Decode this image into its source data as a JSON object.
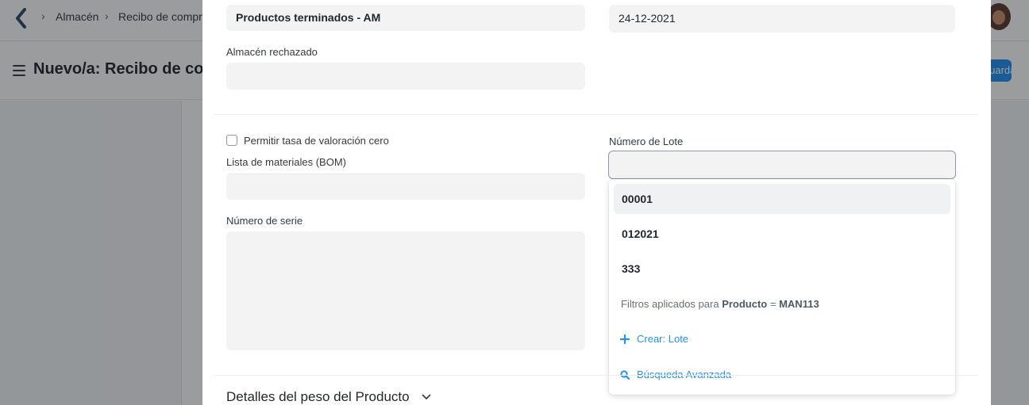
{
  "navbar": {
    "breadcrumbs": [
      "Almacén",
      "Recibo de compra"
    ]
  },
  "page": {
    "title": "Nuevo/a: Recibo de compra",
    "save_label": "Guardar"
  },
  "dialog": {
    "warehouse_value": "Productos terminados - AM",
    "date_value": "24-12-2021",
    "rejected_warehouse_label": "Almacén rechazado",
    "rejected_warehouse_value": "",
    "zero_valuation_label": "Permitir tasa de valoración cero",
    "bom_label": "Lista de materiales (BOM)",
    "bom_value": "",
    "serial_label": "Número de serie",
    "serial_value": "",
    "batch_label": "Número de Lote",
    "batch_value": "",
    "batch_options": [
      "00001",
      "012021",
      "333"
    ],
    "filter_prefix": "Filtros aplicados para",
    "filter_field": "Producto",
    "filter_operator": "=",
    "filter_value": "MAN113",
    "create_label": "Crear: Lote",
    "advanced_search_label": "Búsqueda Avanzada",
    "section_title": "Detalles del peso del Producto"
  },
  "colors": {
    "accent": "#2490ef",
    "overlay": "#101418"
  }
}
